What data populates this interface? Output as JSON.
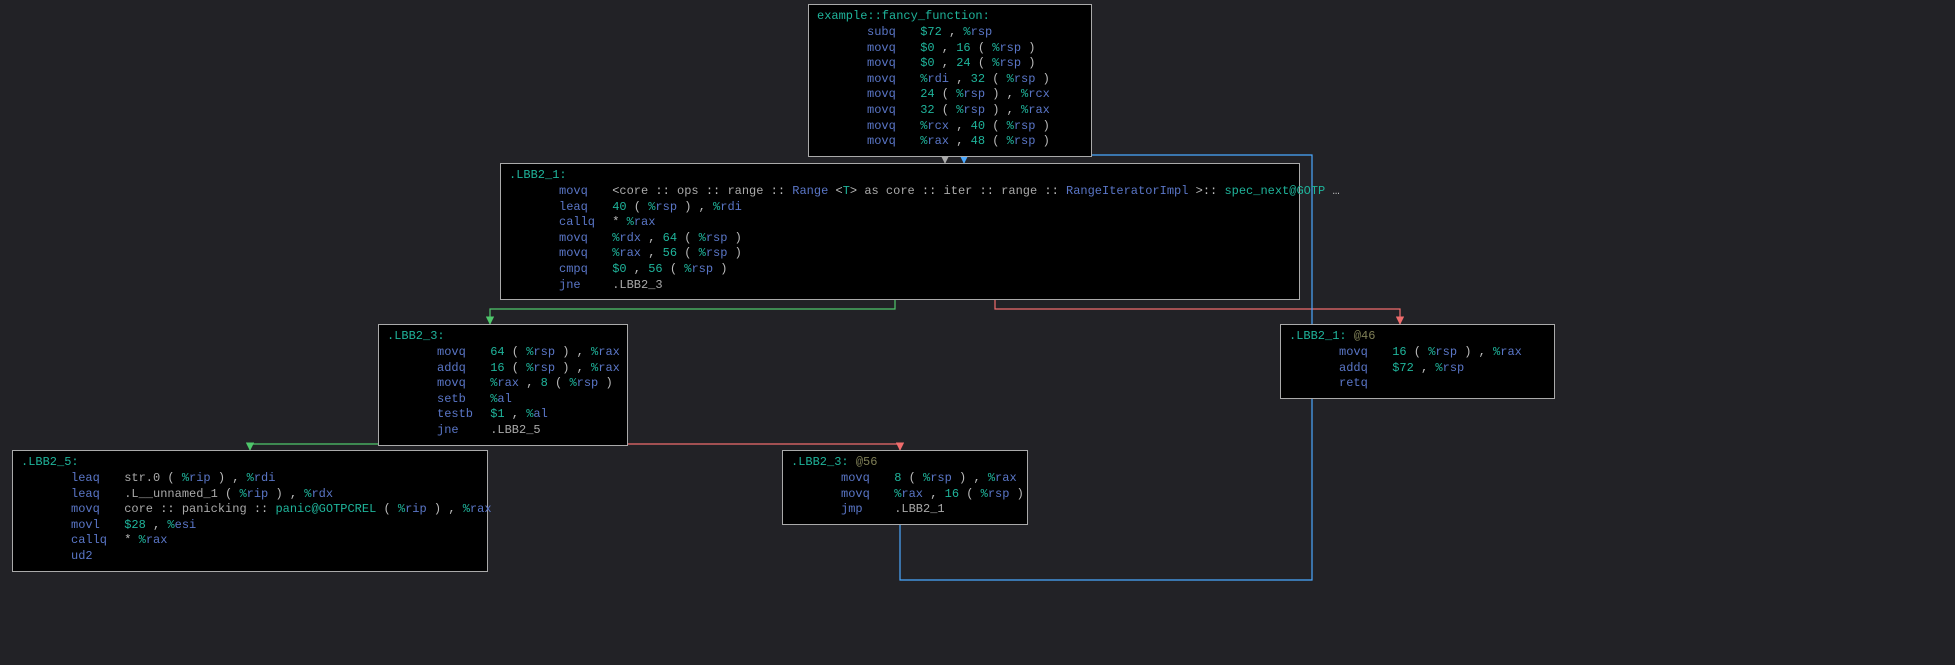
{
  "blocks": {
    "entry": {
      "label": "example::fancy_function:",
      "lines": [
        {
          "m": "subq",
          "args": [
            {
              "t": "imm",
              "v": "$72"
            },
            {
              "t": "punct",
              "v": " ,   "
            },
            {
              "t": "reg",
              "v": "%rsp"
            }
          ]
        },
        {
          "m": "movq",
          "args": [
            {
              "t": "imm",
              "v": "$0"
            },
            {
              "t": "punct",
              "v": " ,   "
            },
            {
              "t": "imm",
              "v": "16"
            },
            {
              "t": "paren",
              "v": " ( "
            },
            {
              "t": "reg",
              "v": "%rsp"
            },
            {
              "t": "paren",
              "v": " ) "
            }
          ]
        },
        {
          "m": "movq",
          "args": [
            {
              "t": "imm",
              "v": "$0"
            },
            {
              "t": "punct",
              "v": " ,   "
            },
            {
              "t": "imm",
              "v": "24"
            },
            {
              "t": "paren",
              "v": " ( "
            },
            {
              "t": "reg",
              "v": "%rsp"
            },
            {
              "t": "paren",
              "v": " ) "
            }
          ]
        },
        {
          "m": "movq",
          "args": [
            {
              "t": "reg",
              "v": "%rdi"
            },
            {
              "t": "punct",
              "v": " ,   "
            },
            {
              "t": "imm",
              "v": "32"
            },
            {
              "t": "paren",
              "v": " ( "
            },
            {
              "t": "reg",
              "v": "%rsp"
            },
            {
              "t": "paren",
              "v": " ) "
            }
          ]
        },
        {
          "m": "movq",
          "args": [
            {
              "t": "imm",
              "v": "24"
            },
            {
              "t": "paren",
              "v": " ( "
            },
            {
              "t": "reg",
              "v": "%rsp"
            },
            {
              "t": "paren",
              "v": " ) "
            },
            {
              "t": "punct",
              "v": " ,   "
            },
            {
              "t": "reg",
              "v": "%rcx"
            }
          ]
        },
        {
          "m": "movq",
          "args": [
            {
              "t": "imm",
              "v": "32"
            },
            {
              "t": "paren",
              "v": " ( "
            },
            {
              "t": "reg",
              "v": "%rsp"
            },
            {
              "t": "paren",
              "v": " ) "
            },
            {
              "t": "punct",
              "v": " ,   "
            },
            {
              "t": "reg",
              "v": "%rax"
            }
          ]
        },
        {
          "m": "movq",
          "args": [
            {
              "t": "reg",
              "v": "%rcx"
            },
            {
              "t": "punct",
              "v": " ,   "
            },
            {
              "t": "imm",
              "v": "40"
            },
            {
              "t": "paren",
              "v": " ( "
            },
            {
              "t": "reg",
              "v": "%rsp"
            },
            {
              "t": "paren",
              "v": " ) "
            }
          ]
        },
        {
          "m": "movq",
          "args": [
            {
              "t": "reg",
              "v": "%rax"
            },
            {
              "t": "punct",
              "v": " ,   "
            },
            {
              "t": "imm",
              "v": "48"
            },
            {
              "t": "paren",
              "v": " ( "
            },
            {
              "t": "reg",
              "v": "%rsp"
            },
            {
              "t": "paren",
              "v": " ) "
            }
          ]
        }
      ]
    },
    "b1": {
      "label": ".LBB2_1:",
      "lines": [
        {
          "m": "movq",
          "args": [
            {
              "t": "punct",
              "v": "<"
            },
            {
              "t": "sym",
              "v": "core"
            },
            {
              "t": "op",
              "v": "  ::  "
            },
            {
              "t": "sym",
              "v": "ops"
            },
            {
              "t": "op",
              "v": " ::  "
            },
            {
              "t": "sym",
              "v": "range"
            },
            {
              "t": "op",
              "v": "   ::   "
            },
            {
              "t": "ty",
              "v": "Range"
            },
            {
              "t": "punct",
              "v": " <"
            },
            {
              "t": "kw",
              "v": "T"
            },
            {
              "t": "punct",
              "v": ">  "
            },
            {
              "t": "sym",
              "v": "as"
            },
            {
              "t": "op",
              "v": "   "
            },
            {
              "t": "sym",
              "v": "core"
            },
            {
              "t": "op",
              "v": "   ::   "
            },
            {
              "t": "sym",
              "v": "iter"
            },
            {
              "t": "op",
              "v": "    ::   "
            },
            {
              "t": "sym",
              "v": "range"
            },
            {
              "t": "op",
              "v": "   ::   "
            },
            {
              "t": "ty",
              "v": "RangeIteratorImpl"
            },
            {
              "t": "op",
              "v": "        >::  "
            },
            {
              "t": "fn",
              "v": "spec_next@GOTP"
            },
            {
              "t": "punct",
              "v": "    …"
            }
          ]
        },
        {
          "m": "leaq",
          "args": [
            {
              "t": "imm",
              "v": "40"
            },
            {
              "t": "paren",
              "v": " ( "
            },
            {
              "t": "reg",
              "v": "%rsp"
            },
            {
              "t": "paren",
              "v": " ) "
            },
            {
              "t": "punct",
              "v": " ,   "
            },
            {
              "t": "reg",
              "v": "%rdi"
            }
          ]
        },
        {
          "m": "callq",
          "args": [
            {
              "t": "star",
              "v": "*     "
            },
            {
              "t": "reg",
              "v": "%rax"
            }
          ]
        },
        {
          "m": "movq",
          "args": [
            {
              "t": "reg",
              "v": "%rdx"
            },
            {
              "t": "punct",
              "v": " ,   "
            },
            {
              "t": "imm",
              "v": "64"
            },
            {
              "t": "paren",
              "v": " ( "
            },
            {
              "t": "reg",
              "v": "%rsp"
            },
            {
              "t": "paren",
              "v": " ) "
            }
          ]
        },
        {
          "m": "movq",
          "args": [
            {
              "t": "reg",
              "v": "%rax"
            },
            {
              "t": "punct",
              "v": " ,   "
            },
            {
              "t": "imm",
              "v": "56"
            },
            {
              "t": "paren",
              "v": " ( "
            },
            {
              "t": "reg",
              "v": "%rsp"
            },
            {
              "t": "paren",
              "v": " ) "
            }
          ]
        },
        {
          "m": "cmpq",
          "args": [
            {
              "t": "imm",
              "v": "$0"
            },
            {
              "t": "punct",
              "v": " ,   "
            },
            {
              "t": "imm",
              "v": "56"
            },
            {
              "t": "paren",
              "v": " ( "
            },
            {
              "t": "reg",
              "v": "%rsp"
            },
            {
              "t": "paren",
              "v": " ) "
            }
          ]
        },
        {
          "m": "jne",
          "args": [
            {
              "t": "lbl",
              "v": ".LBB2_3"
            }
          ]
        }
      ]
    },
    "b3": {
      "label": ".LBB2_3:",
      "lines": [
        {
          "m": "movq",
          "args": [
            {
              "t": "imm",
              "v": "64"
            },
            {
              "t": "paren",
              "v": " ( "
            },
            {
              "t": "reg",
              "v": "%rsp"
            },
            {
              "t": "paren",
              "v": " ) "
            },
            {
              "t": "punct",
              "v": " ,   "
            },
            {
              "t": "reg",
              "v": "%rax"
            }
          ]
        },
        {
          "m": "addq",
          "args": [
            {
              "t": "imm",
              "v": "16"
            },
            {
              "t": "paren",
              "v": " ( "
            },
            {
              "t": "reg",
              "v": "%rsp"
            },
            {
              "t": "paren",
              "v": " ) "
            },
            {
              "t": "punct",
              "v": " ,   "
            },
            {
              "t": "reg",
              "v": "%rax"
            }
          ]
        },
        {
          "m": "movq",
          "args": [
            {
              "t": "reg",
              "v": "%rax"
            },
            {
              "t": "punct",
              "v": " ,   "
            },
            {
              "t": "imm",
              "v": "8"
            },
            {
              "t": "paren",
              "v": " ( "
            },
            {
              "t": "reg",
              "v": "%rsp"
            },
            {
              "t": "paren",
              "v": " ) "
            }
          ]
        },
        {
          "m": "setb",
          "args": [
            {
              "t": "reg",
              "v": "%al"
            }
          ]
        },
        {
          "m": "testb",
          "args": [
            {
              "t": "imm",
              "v": "$1"
            },
            {
              "t": "punct",
              "v": " ,   "
            },
            {
              "t": "reg",
              "v": "%al"
            }
          ]
        },
        {
          "m": "jne",
          "args": [
            {
              "t": "lbl",
              "v": ".LBB2_5"
            }
          ]
        }
      ]
    },
    "b1_46": {
      "label": ".LBB2_1:",
      "label_at": "@46",
      "lines": [
        {
          "m": "movq",
          "args": [
            {
              "t": "imm",
              "v": "16"
            },
            {
              "t": "paren",
              "v": " ( "
            },
            {
              "t": "reg",
              "v": "%rsp"
            },
            {
              "t": "paren",
              "v": " ) "
            },
            {
              "t": "punct",
              "v": " ,   "
            },
            {
              "t": "reg",
              "v": "%rax"
            }
          ]
        },
        {
          "m": "addq",
          "args": [
            {
              "t": "imm",
              "v": "$72"
            },
            {
              "t": "punct",
              "v": " ,   "
            },
            {
              "t": "reg",
              "v": "%rsp"
            }
          ]
        },
        {
          "m": "retq",
          "args": []
        }
      ]
    },
    "b5": {
      "label": ".LBB2_5:",
      "lines": [
        {
          "m": "leaq",
          "args": [
            {
              "t": "sym",
              "v": "str.0"
            },
            {
              "t": "paren",
              "v": "     ( "
            },
            {
              "t": "reg",
              "v": "%rip"
            },
            {
              "t": "paren",
              "v": " ) "
            },
            {
              "t": "punct",
              "v": " ,   "
            },
            {
              "t": "reg",
              "v": "%rdi"
            }
          ]
        },
        {
          "m": "leaq",
          "args": [
            {
              "t": "sym",
              "v": ".L__unnamed_1"
            },
            {
              "t": "paren",
              "v": "     ( "
            },
            {
              "t": "reg",
              "v": "%rip"
            },
            {
              "t": "paren",
              "v": " ) "
            },
            {
              "t": "punct",
              "v": " ,   "
            },
            {
              "t": "reg",
              "v": "%rdx"
            }
          ]
        },
        {
          "m": "movq",
          "args": [
            {
              "t": "sym",
              "v": "core"
            },
            {
              "t": "op",
              "v": "  ::  "
            },
            {
              "t": "sym",
              "v": "panicking"
            },
            {
              "t": "op",
              "v": "     ::  "
            },
            {
              "t": "fn",
              "v": "panic@GOTPCREL"
            },
            {
              "t": "paren",
              "v": " ( "
            },
            {
              "t": "reg",
              "v": "%rip"
            },
            {
              "t": "paren",
              "v": " ) "
            },
            {
              "t": "punct",
              "v": " ,   "
            },
            {
              "t": "reg",
              "v": "%rax"
            }
          ]
        },
        {
          "m": "movl",
          "args": [
            {
              "t": "imm",
              "v": "$28"
            },
            {
              "t": "punct",
              "v": " ,   "
            },
            {
              "t": "reg",
              "v": "%esi"
            }
          ]
        },
        {
          "m": "callq",
          "args": [
            {
              "t": "star",
              "v": "*     "
            },
            {
              "t": "reg",
              "v": "%rax"
            }
          ]
        },
        {
          "m": "ud2",
          "args": []
        }
      ]
    },
    "b3_56": {
      "label": ".LBB2_3:",
      "label_at": "@56",
      "lines": [
        {
          "m": "movq",
          "args": [
            {
              "t": "imm",
              "v": "8"
            },
            {
              "t": "paren",
              "v": " ( "
            },
            {
              "t": "reg",
              "v": "%rsp"
            },
            {
              "t": "paren",
              "v": " ) "
            },
            {
              "t": "punct",
              "v": " ,   "
            },
            {
              "t": "reg",
              "v": "%rax"
            }
          ]
        },
        {
          "m": "movq",
          "args": [
            {
              "t": "reg",
              "v": "%rax"
            },
            {
              "t": "punct",
              "v": " ,   "
            },
            {
              "t": "imm",
              "v": "16"
            },
            {
              "t": "paren",
              "v": " ( "
            },
            {
              "t": "reg",
              "v": "%rsp"
            },
            {
              "t": "paren",
              "v": " ) "
            }
          ]
        },
        {
          "m": "jmp",
          "args": [
            {
              "t": "lbl",
              "v": ".LBB2_1"
            }
          ]
        }
      ]
    }
  },
  "edges": {
    "colors": {
      "uncond": "#aaaaaa",
      "true": "#4fc76b",
      "false": "#f06c6c",
      "back": "#4aa8ff"
    }
  }
}
